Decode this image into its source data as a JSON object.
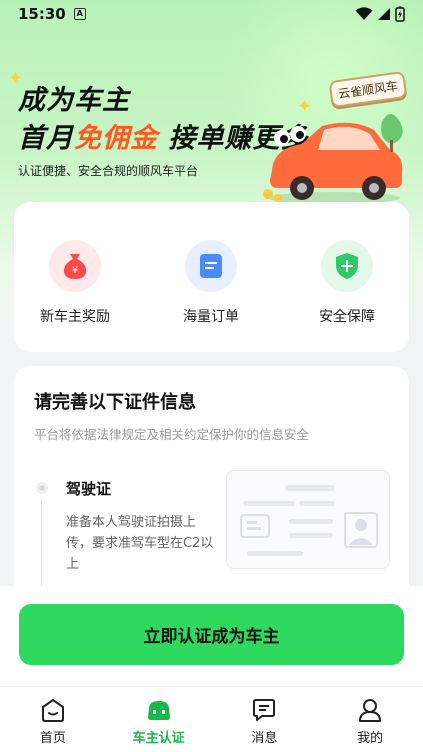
{
  "status_bar": {
    "time": "15:30",
    "notification_badge": "A"
  },
  "hero": {
    "headline_line1": "成为车主",
    "headline_line2_prefix": "首月",
    "headline_line2_accent": "免佣金",
    "headline_line2_suffix": "接单赚更多",
    "subline": "认证便捷、安全合规的顺风车平台",
    "brand_tag": "云雀顺风车"
  },
  "benefits": [
    {
      "label": "新车主奖励",
      "icon": "money-bag-icon",
      "color": "#ff4a4a"
    },
    {
      "label": "海量订单",
      "icon": "document-icon",
      "color": "#4a8cff"
    },
    {
      "label": "安全保障",
      "icon": "shield-icon",
      "color": "#2fc86a"
    }
  ],
  "documents": {
    "title": "请完善以下证件信息",
    "description": "平台将依据法律规定及相关约定保护你的信息安全",
    "items": [
      {
        "name": "驾驶证",
        "tip": "准备本人驾驶证拍摄上传，要求准驾车型在C2以上"
      }
    ]
  },
  "cta": {
    "label": "立即认证成为车主"
  },
  "tabs": [
    {
      "label": "首页",
      "icon": "home-icon",
      "active": false
    },
    {
      "label": "车主认证",
      "icon": "car-icon",
      "active": true
    },
    {
      "label": "消息",
      "icon": "message-icon",
      "active": false
    },
    {
      "label": "我的",
      "icon": "profile-icon",
      "active": false
    }
  ],
  "colors": {
    "accent_green": "#2fd95f",
    "accent_orange": "#ff5a1f",
    "active_tab": "#19b84a"
  }
}
